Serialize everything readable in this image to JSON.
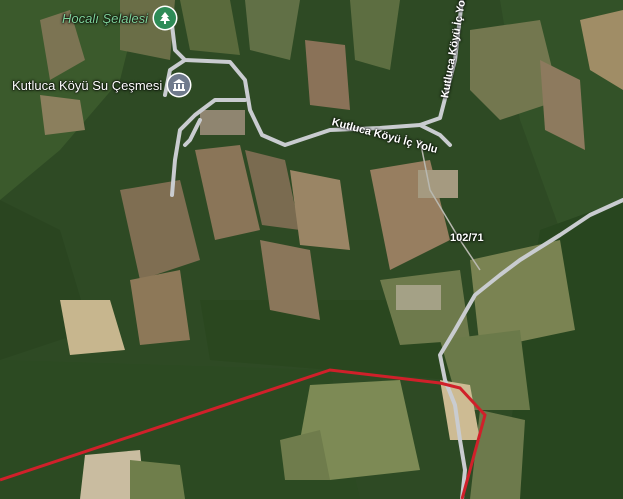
{
  "map": {
    "type": "satellite",
    "colors": {
      "forest": "#2b4a22",
      "field": "#8a7a5a",
      "road": "#c9ccd0",
      "boundary": "#d0202a",
      "park_pin": "#2e8b57",
      "heritage_pin": "#6f7a8c"
    }
  },
  "pois": [
    {
      "name": "Hocalı Şelalesi",
      "icon": "tree-icon",
      "category": "park"
    },
    {
      "name": "Kutluca Köyü Su Çeşmesi",
      "icon": "museum-icon",
      "category": "heritage"
    }
  ],
  "roads": [
    {
      "name": "Kutluca Köyü İç Yolu"
    },
    {
      "name": "Kutluca Köyü İç Yolu"
    }
  ],
  "route_numbers": [
    "102/71"
  ]
}
